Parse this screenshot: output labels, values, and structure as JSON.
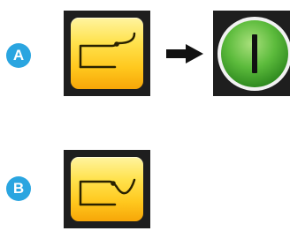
{
  "steps": [
    {
      "label": "A",
      "color": "#2aa5e0",
      "icon": "stitch-pattern-a-icon"
    },
    {
      "label": "B",
      "color": "#2aa5e0",
      "icon": "stitch-pattern-b-icon"
    }
  ],
  "sequence_arrow": {
    "icon": "right-arrow-icon"
  },
  "power_button": {
    "icon": "power-on-icon",
    "color": "#4fb535"
  },
  "key_face_color": "#ffd21e"
}
